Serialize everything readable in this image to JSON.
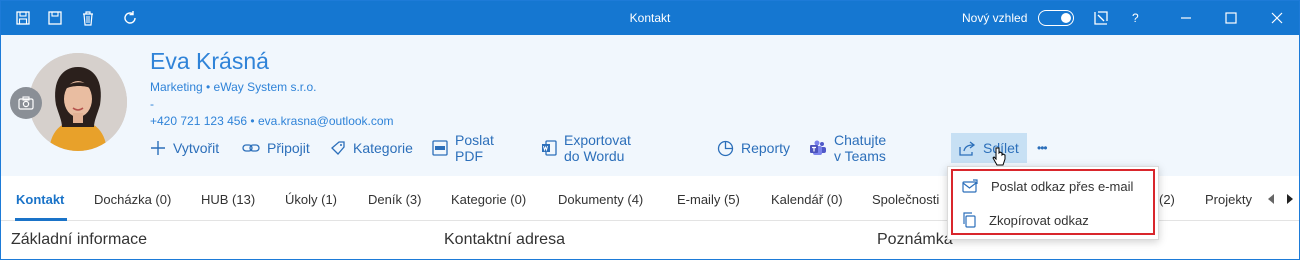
{
  "window": {
    "title": "Kontakt",
    "new_look_label": "Nový vzhled",
    "new_look_on": true,
    "help_label": "?"
  },
  "contact": {
    "name": "Eva Krásná",
    "company_line": "Marketing • eWay System s.r.o.",
    "secondary_line": "-",
    "contact_line": "+420 721 123 456 • eva.krasna@outlook.com"
  },
  "actions": [
    {
      "label": "Vytvořit",
      "icon": "plus-icon"
    },
    {
      "label": "Připojit",
      "icon": "link-icon"
    },
    {
      "label": "Kategorie",
      "icon": "tag-icon"
    },
    {
      "label": "Poslat PDF",
      "icon": "pdf-icon"
    },
    {
      "label": "Exportovat do Wordu",
      "icon": "word-icon"
    },
    {
      "label": "Reporty",
      "icon": "pie-chart-icon"
    },
    {
      "label": "Chatujte v Teams",
      "icon": "teams-icon"
    },
    {
      "label": "Sdílet",
      "icon": "share-icon",
      "active": true
    },
    {
      "label": "•••",
      "icon": "more-icon"
    }
  ],
  "tabs": [
    {
      "label": "Kontakt",
      "active": true
    },
    {
      "label": "Docházka (0)"
    },
    {
      "label": "HUB (13)"
    },
    {
      "label": "Úkoly (1)"
    },
    {
      "label": "Deník (3)"
    },
    {
      "label": "Kategorie (0)"
    },
    {
      "label": "Dokumenty (4)"
    },
    {
      "label": "E-maily (5)"
    },
    {
      "label": "Kalendář (0)"
    },
    {
      "label": "Společnosti"
    },
    {
      "label": "(2)"
    },
    {
      "label": "Projekty"
    }
  ],
  "sections": {
    "basic": "Základní informace",
    "address": "Kontaktní adresa",
    "notes": "Poznámka"
  },
  "share_menu": {
    "items": [
      {
        "label": "Poslat odkaz přes e-mail",
        "icon": "email-link-icon"
      },
      {
        "label": "Zkopírovat odkaz",
        "icon": "copy-icon"
      }
    ]
  },
  "colors": {
    "titlebar": "#1577d1",
    "header_bg": "#f1f7fd",
    "accent": "#2f83d8",
    "highlight_border": "#d9262c"
  }
}
